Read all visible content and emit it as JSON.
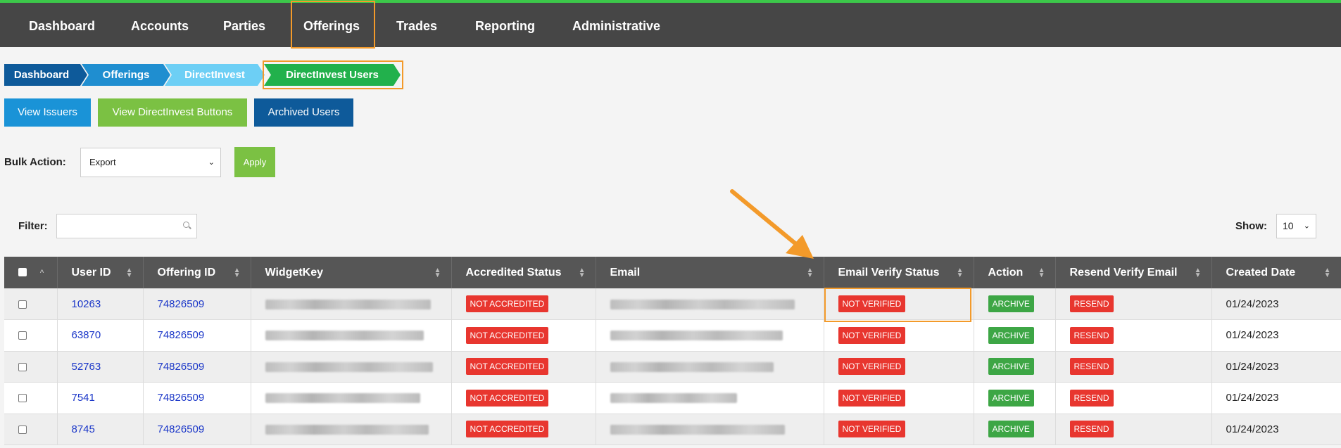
{
  "nav": {
    "items": [
      "Dashboard",
      "Accounts",
      "Parties",
      "Offerings",
      "Trades",
      "Reporting",
      "Administrative"
    ]
  },
  "breadcrumb": [
    "Dashboard",
    "Offerings",
    "DirectInvest",
    "DirectInvest Users"
  ],
  "buttons": {
    "view_issuers": "View Issuers",
    "view_directinvest_buttons": "View DirectInvest Buttons",
    "archived_users": "Archived Users"
  },
  "bulk": {
    "label": "Bulk Action:",
    "selected": "Export",
    "apply_label": "Apply"
  },
  "filter": {
    "label": "Filter:",
    "value": ""
  },
  "show": {
    "label": "Show:",
    "selected": "10"
  },
  "table": {
    "columns": [
      "User ID",
      "Offering ID",
      "WidgetKey",
      "Accredited Status",
      "Email",
      "Email Verify Status",
      "Action",
      "Resend Verify Email",
      "Created Date"
    ],
    "rows": [
      {
        "user_id": "10263",
        "offering_id": "74826509",
        "accredited": "NOT ACCREDITED",
        "verify": "NOT VERIFIED",
        "action": "ARCHIVE",
        "resend": "RESEND",
        "created": "01/24/2023"
      },
      {
        "user_id": "63870",
        "offering_id": "74826509",
        "accredited": "NOT ACCREDITED",
        "verify": "NOT VERIFIED",
        "action": "ARCHIVE",
        "resend": "RESEND",
        "created": "01/24/2023"
      },
      {
        "user_id": "52763",
        "offering_id": "74826509",
        "accredited": "NOT ACCREDITED",
        "verify": "NOT VERIFIED",
        "action": "ARCHIVE",
        "resend": "RESEND",
        "created": "01/24/2023"
      },
      {
        "user_id": "7541",
        "offering_id": "74826509",
        "accredited": "NOT ACCREDITED",
        "verify": "NOT VERIFIED",
        "action": "ARCHIVE",
        "resend": "RESEND",
        "created": "01/24/2023"
      },
      {
        "user_id": "8745",
        "offering_id": "74826509",
        "accredited": "NOT ACCREDITED",
        "verify": "NOT VERIFIED",
        "action": "ARCHIVE",
        "resend": "RESEND",
        "created": "01/24/2023"
      }
    ]
  },
  "colors": {
    "topbar": "#464646",
    "topbar_accent": "#3cc84a",
    "highlight": "#f39a2a",
    "badge_red": "#e8362f",
    "badge_green": "#3da645",
    "btn_blue": "#1a93d7",
    "btn_green": "#7bc143",
    "btn_navy": "#0e5a9a"
  }
}
